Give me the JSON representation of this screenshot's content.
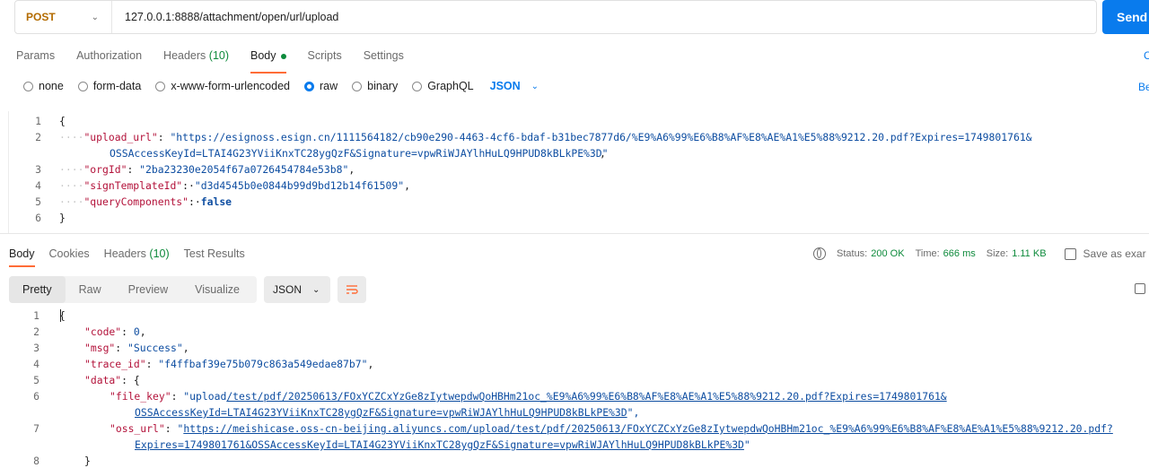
{
  "request": {
    "method": "POST",
    "url": "127.0.0.1:8888/attachment/open/url/upload",
    "send_label": "Send",
    "tabs": [
      {
        "label": "Params"
      },
      {
        "label": "Authorization"
      },
      {
        "label": "Headers",
        "count": "(10)"
      },
      {
        "label": "Body"
      },
      {
        "label": "Scripts"
      },
      {
        "label": "Settings"
      }
    ],
    "right_cut_label": "C",
    "body_types": [
      "none",
      "form-data",
      "x-www-form-urlencoded",
      "raw",
      "binary",
      "GraphQL"
    ],
    "body_format": "JSON",
    "right_cut_label2": "Be",
    "body_lines": {
      "l1": "{",
      "l2_key": "\"upload_url\"",
      "l2_val": "\"https://esignoss.esign.cn/1111564182/cb90e290-4463-4cf6-bdaf-b31bec7877d6/%E9%A6%99%E6%B8%AF%E8%AE%A1%E5%88%9212.20.pdf?Expires=1749801761&",
      "l2_cont": "OSSAccessKeyId=LTAI4G23YViiKnxTC28ygQzF&Signature=vpwRiWJAYlhHuLQ9HPUD8kBLkPE%3D\"",
      "l3_key": "\"orgId\"",
      "l3_val": "\"2ba23230e2054f67a0726454784e53b8\"",
      "l4_key": "\"signTemplateId\"",
      "l4_val": "\"d3d4545b0e0844b99d9bd12b14f61509\"",
      "l5_key": "\"queryComponents\"",
      "l5_val": "false",
      "l6": "}"
    }
  },
  "response": {
    "tabs": [
      {
        "label": "Body"
      },
      {
        "label": "Cookies"
      },
      {
        "label": "Headers",
        "count": "(10)"
      },
      {
        "label": "Test Results"
      }
    ],
    "status_label": "Status:",
    "status_value": "200 OK",
    "time_label": "Time:",
    "time_value": "666 ms",
    "size_label": "Size:",
    "size_value": "1.11 KB",
    "save_label": "Save as exar",
    "views": [
      "Pretty",
      "Raw",
      "Preview",
      "Visualize"
    ],
    "format": "JSON",
    "body_lines": {
      "l1": "{",
      "code_key": "\"code\"",
      "code_val": "0",
      "msg_key": "\"msg\"",
      "msg_val": "\"Success\"",
      "trace_key": "\"trace_id\"",
      "trace_val": "\"f4ffbaf39e75b079c863a549edae87b7\"",
      "data_key": "\"data\"",
      "file_key": "\"file_key\"",
      "file_val_a": "\"upload",
      "file_val_b": "/test/pdf/20250613/FOxYCZCxYzGe8zIytwepdwQoHBHm21oc_%E9%A6%99%E6%B8%AF%E8%AE%A1%E5%88%9212.20.pdf?Expires=1749801761&",
      "file_cont": "OSSAccessKeyId=LTAI4G23YViiKnxTC28ygQzF&Signature=vpwRiWJAYlhHuLQ9HPUD8kBLkPE%3D",
      "file_end": "\",",
      "oss_key": "\"oss_url\"",
      "oss_val": "https://meishicase.oss-cn-beijing.aliyuncs.com/upload/test/pdf/20250613/FOxYCZCxYzGe8zIytwepdwQoHBHm21oc_%E9%A6%99%E6%B8%AF%E8%AE%A1%E5%88%9212.20.pdf?",
      "oss_cont": "Expires=1749801761&OSSAccessKeyId=LTAI4G23YViiKnxTC28ygQzF&Signature=vpwRiWJAYlhHuLQ9HPUD8kBLkPE%3D",
      "close_obj": "}"
    },
    "line_numbers": [
      "1",
      "2",
      "3",
      "4",
      "5",
      "6",
      "7",
      "8"
    ]
  },
  "request_line_numbers": [
    "1",
    "2",
    "3",
    "4",
    "5",
    "6"
  ]
}
